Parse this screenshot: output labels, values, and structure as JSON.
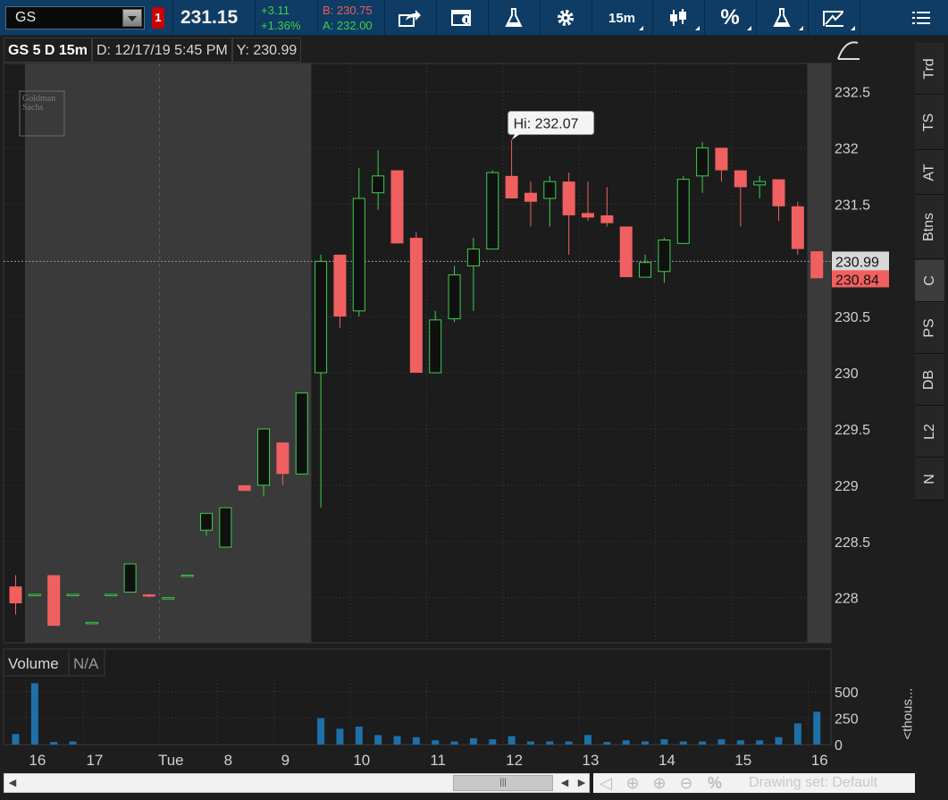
{
  "toolbar": {
    "symbol": "GS",
    "alert_count": "1",
    "last_price": "231.15",
    "net_change": "+3.11",
    "net_change_pct": "+1.36%",
    "bid": "B: 230.75",
    "ask": "A: 232.00",
    "timeframe": "15m",
    "percent_label": "%",
    "icons": [
      "share-icon",
      "info-window-icon",
      "flask-icon",
      "gear-icon",
      "candlestick-icon",
      "percent-icon",
      "studies-flask-icon",
      "drawing-icon",
      "menu-icon"
    ]
  },
  "chart_header": {
    "title": "GS 5 D 15m",
    "date": "D: 12/17/19 5:45 PM",
    "y_readout": "Y: 230.99"
  },
  "colors": {
    "up": "#3ecf4a",
    "down": "#f06060",
    "extended_hours_bg": "#3a3a3a",
    "regular_bg": "#1c1c1c",
    "volume": "#1f6fa8",
    "toolbar": "#0f3c64"
  },
  "logo_text": "Goldman Sachs",
  "hi_label": "Hi: 232.07",
  "price_labels": {
    "crosshair": "230.99",
    "last": "230.84"
  },
  "volume_panel": {
    "label": "Volume",
    "value": "N/A",
    "unit_label": "<thous..."
  },
  "right_tabs": [
    "Trd",
    "TS",
    "AT",
    "Btns",
    "C",
    "PS",
    "DB",
    "L2",
    "N"
  ],
  "active_tab": "C",
  "bottom": {
    "drawing_set": "Drawing set: Default",
    "scroll_thumb": "|||"
  },
  "chart_data": {
    "type": "candlestick",
    "y_ticks": [
      "232.5",
      "232",
      "231.5",
      "231",
      "230.5",
      "230",
      "229.5",
      "229",
      "228.5",
      "228"
    ],
    "ylim": [
      227.6,
      232.75
    ],
    "volume_ticks": [
      "500",
      "250",
      "0"
    ],
    "volume_lim": [
      0,
      650
    ],
    "x_labels": [
      {
        "label": "16",
        "bar": 1
      },
      {
        "label": "17",
        "bar": 4
      },
      {
        "label": "Tue",
        "bar": 8
      },
      {
        "label": "8",
        "bar": 11
      },
      {
        "label": "9",
        "bar": 14
      },
      {
        "label": "10",
        "bar": 18
      },
      {
        "label": "11",
        "bar": 22
      },
      {
        "label": "12",
        "bar": 26
      },
      {
        "label": "13",
        "bar": 30
      },
      {
        "label": "14",
        "bar": 34
      },
      {
        "label": "15",
        "bar": 38
      },
      {
        "label": "16",
        "bar": 42
      }
    ],
    "session_bars": {
      "extended_before": 16,
      "extended_after_start": 42
    },
    "candles": [
      {
        "o": 228.1,
        "h": 228.2,
        "l": 227.85,
        "c": 227.95,
        "v": 100
      },
      {
        "o": 228.03,
        "h": 228.03,
        "l": 228.03,
        "c": 228.03,
        "v": 580
      },
      {
        "o": 228.2,
        "h": 228.2,
        "l": 227.75,
        "c": 227.75,
        "v": 25
      },
      {
        "o": 228.03,
        "h": 228.03,
        "l": 228.03,
        "c": 228.03,
        "v": 30
      },
      {
        "o": 227.78,
        "h": 227.78,
        "l": 227.78,
        "c": 227.78,
        "v": 0
      },
      {
        "o": 228.03,
        "h": 228.03,
        "l": 228.03,
        "c": 228.03,
        "v": 0
      },
      {
        "o": 228.05,
        "h": 228.3,
        "l": 228.05,
        "c": 228.3,
        "v": 0
      },
      {
        "o": 228.03,
        "h": 228.03,
        "l": 228.0,
        "c": 228.01,
        "v": 0
      },
      {
        "o": 228.0,
        "h": 228.0,
        "l": 228.0,
        "c": 228.0,
        "v": 0
      },
      {
        "o": 228.2,
        "h": 228.2,
        "l": 228.2,
        "c": 228.2,
        "v": 0
      },
      {
        "o": 228.6,
        "h": 228.75,
        "l": 228.55,
        "c": 228.75,
        "v": 0
      },
      {
        "o": 228.45,
        "h": 228.8,
        "l": 228.45,
        "c": 228.8,
        "v": 0
      },
      {
        "o": 229.0,
        "h": 229.0,
        "l": 228.95,
        "c": 228.95,
        "v": 0
      },
      {
        "o": 229.0,
        "h": 229.5,
        "l": 228.9,
        "c": 229.5,
        "v": 0
      },
      {
        "o": 229.38,
        "h": 229.38,
        "l": 229.0,
        "c": 229.1,
        "v": 0
      },
      {
        "o": 229.1,
        "h": 229.82,
        "l": 229.1,
        "c": 229.82,
        "v": 0
      },
      {
        "o": 230.0,
        "h": 231.05,
        "l": 228.8,
        "c": 230.99,
        "v": 250
      },
      {
        "o": 231.05,
        "h": 231.05,
        "l": 230.4,
        "c": 230.5,
        "v": 150
      },
      {
        "o": 230.55,
        "h": 231.82,
        "l": 230.5,
        "c": 231.55,
        "v": 170
      },
      {
        "o": 231.6,
        "h": 231.98,
        "l": 231.45,
        "c": 231.75,
        "v": 90
      },
      {
        "o": 231.8,
        "h": 231.8,
        "l": 231.15,
        "c": 231.15,
        "v": 80
      },
      {
        "o": 231.2,
        "h": 231.25,
        "l": 230.0,
        "c": 230.0,
        "v": 70
      },
      {
        "o": 230.0,
        "h": 230.55,
        "l": 230.0,
        "c": 230.47,
        "v": 40
      },
      {
        "o": 230.48,
        "h": 230.95,
        "l": 230.45,
        "c": 230.87,
        "v": 30
      },
      {
        "o": 230.95,
        "h": 231.2,
        "l": 230.55,
        "c": 231.1,
        "v": 60
      },
      {
        "o": 231.1,
        "h": 231.8,
        "l": 231.1,
        "c": 231.78,
        "v": 50
      },
      {
        "o": 231.75,
        "h": 232.07,
        "l": 231.55,
        "c": 231.55,
        "v": 80
      },
      {
        "o": 231.6,
        "h": 231.7,
        "l": 231.3,
        "c": 231.52,
        "v": 30
      },
      {
        "o": 231.55,
        "h": 231.75,
        "l": 231.3,
        "c": 231.7,
        "v": 30
      },
      {
        "o": 231.7,
        "h": 231.78,
        "l": 231.05,
        "c": 231.4,
        "v": 30
      },
      {
        "o": 231.42,
        "h": 231.7,
        "l": 231.35,
        "c": 231.38,
        "v": 90
      },
      {
        "o": 231.4,
        "h": 231.65,
        "l": 231.3,
        "c": 231.33,
        "v": 25
      },
      {
        "o": 231.3,
        "h": 231.3,
        "l": 230.85,
        "c": 230.85,
        "v": 40
      },
      {
        "o": 230.85,
        "h": 231.05,
        "l": 230.85,
        "c": 230.98,
        "v": 30
      },
      {
        "o": 230.9,
        "h": 231.2,
        "l": 230.8,
        "c": 231.18,
        "v": 50
      },
      {
        "o": 231.15,
        "h": 231.75,
        "l": 231.15,
        "c": 231.72,
        "v": 30
      },
      {
        "o": 231.75,
        "h": 232.05,
        "l": 231.6,
        "c": 232.0,
        "v": 30
      },
      {
        "o": 232.0,
        "h": 232.0,
        "l": 231.7,
        "c": 231.8,
        "v": 50
      },
      {
        "o": 231.8,
        "h": 231.8,
        "l": 231.3,
        "c": 231.65,
        "v": 40
      },
      {
        "o": 231.67,
        "h": 231.75,
        "l": 231.55,
        "c": 231.7,
        "v": 40
      },
      {
        "o": 231.72,
        "h": 231.72,
        "l": 231.35,
        "c": 231.48,
        "v": 70
      },
      {
        "o": 231.48,
        "h": 231.52,
        "l": 231.05,
        "c": 231.1,
        "v": 200
      },
      {
        "o": 231.08,
        "h": 231.08,
        "l": 230.84,
        "c": 230.84,
        "v": 310
      }
    ]
  }
}
